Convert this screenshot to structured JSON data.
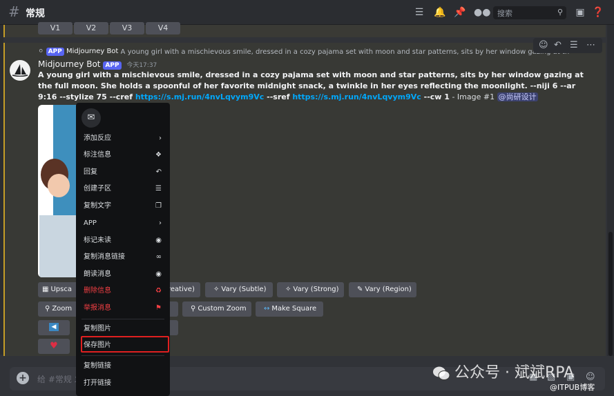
{
  "header": {
    "channel": "常规",
    "search_placeholder": "搜索",
    "icons": [
      "threads-icon",
      "bell-icon",
      "pin-icon",
      "members-icon",
      "search-icon",
      "inbox-icon",
      "help-icon"
    ]
  },
  "prev_buttons": [
    "V1",
    "V2",
    "V3",
    "V4"
  ],
  "message": {
    "reply_author": "Midjourney Bot",
    "reply_badge": "APP",
    "reply_text": "A young girl with a mischievous smile, dressed in a cozy pajama set with moon and star patterns, sits by her window gazing at the full moon. She holds",
    "author": "Midjourney Bot",
    "badge": "APP",
    "time": "今天17:37",
    "prompt_bold": "A young girl with a mischievous smile, dressed in a cozy pajama set with moon and star patterns, sits by her window gazing at the full moon. She holds a spoonful of her favorite midnight snack, a twinkle in her eyes reflecting the moonlight. --niji 6 --ar 9:16 --stylize 75 --cref ",
    "link1": "https://s.mj.run/4nvLqvym9Vc",
    "sref_prefix": " --sref ",
    "link2": "https://s.mj.run/4nvLqvym9Vc",
    "cw": " --cw 1",
    "suffix": " - Image #1 ",
    "mention": "@尚研设计"
  },
  "action_buttons": {
    "upscale": "Upsca",
    "creative": "reative)",
    "vary_subtle": "Vary (Subtle)",
    "vary_strong": "Vary (Strong)",
    "vary_region": "Vary (Region)",
    "zoom": "Zoom",
    "custom_zoom": "Custom Zoom",
    "make_square": "Make Square"
  },
  "context_menu": {
    "items": [
      {
        "label": "添加反应",
        "icon": "chevron-right-icon"
      },
      {
        "label": "标注信息",
        "icon": "pin-icon"
      },
      {
        "label": "回复",
        "icon": "reply-icon"
      },
      {
        "label": "创建子区",
        "icon": "thread-icon"
      },
      {
        "label": "复制文字",
        "icon": "copy-icon"
      },
      {
        "label": "APP",
        "icon": "chevron-right-icon"
      },
      {
        "label": "标记未读",
        "icon": "unread-icon"
      },
      {
        "label": "复制消息链接",
        "icon": "link-icon"
      },
      {
        "label": "朗读消息",
        "icon": "speaker-icon"
      },
      {
        "label": "删除信息",
        "icon": "trash-icon",
        "danger": true
      },
      {
        "label": "举报消息",
        "icon": "flag-icon",
        "danger": true
      },
      {
        "label": "复制图片"
      },
      {
        "label": "保存图片"
      },
      {
        "label": "复制链接"
      },
      {
        "label": "打开链接"
      }
    ]
  },
  "composer": {
    "placeholder": "给 #常规 发"
  },
  "watermark": {
    "main": "公众号 · 斌斌RPA",
    "sub": "@ITPUB博客"
  }
}
